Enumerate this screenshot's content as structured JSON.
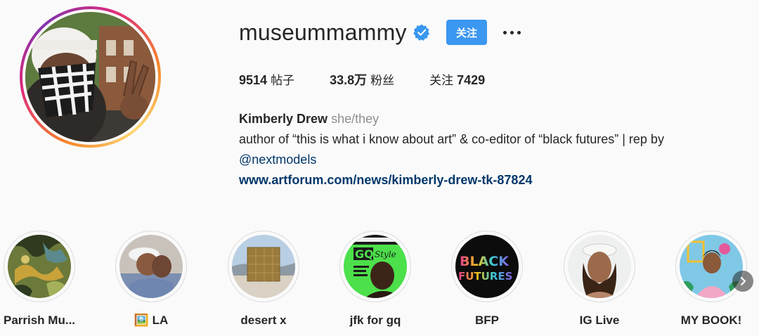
{
  "profile": {
    "username": "museummammy",
    "verified": true,
    "follow_label": "关注",
    "more_label": "..."
  },
  "stats": {
    "posts_value": "9514",
    "posts_label": "帖子",
    "followers_value": "33.8万",
    "followers_label": "粉丝",
    "following_label": "关注",
    "following_value": "7429"
  },
  "bio": {
    "full_name": "Kimberly Drew",
    "pronouns": "she/they",
    "line1": "author of “this is what i know about art” & co-editor of “black futures” | rep by",
    "mention": "@nextmodels",
    "website": "www.artforum.com/news/kimberly-drew-tk-87824"
  },
  "highlights": [
    {
      "label": "Parrish Mu...",
      "icon": "camouflage-painting"
    },
    {
      "label": "🖼️ LA",
      "icon": "two-people-photo"
    },
    {
      "label": "desert x",
      "icon": "desert-cube-sculpture"
    },
    {
      "label": "jfk for gq",
      "icon": "gq-style-cover"
    },
    {
      "label": "BFP",
      "icon": "black-futures-logo"
    },
    {
      "label": "IG Live",
      "icon": "person-portrait"
    },
    {
      "label": "MY BOOK!",
      "icon": "illustrated-book-cover"
    }
  ],
  "colors": {
    "follow_button": "#3b97f0",
    "link": "#00376b",
    "verified_badge": "#3897f0",
    "text": "#262626",
    "muted": "#8e8e8e"
  }
}
